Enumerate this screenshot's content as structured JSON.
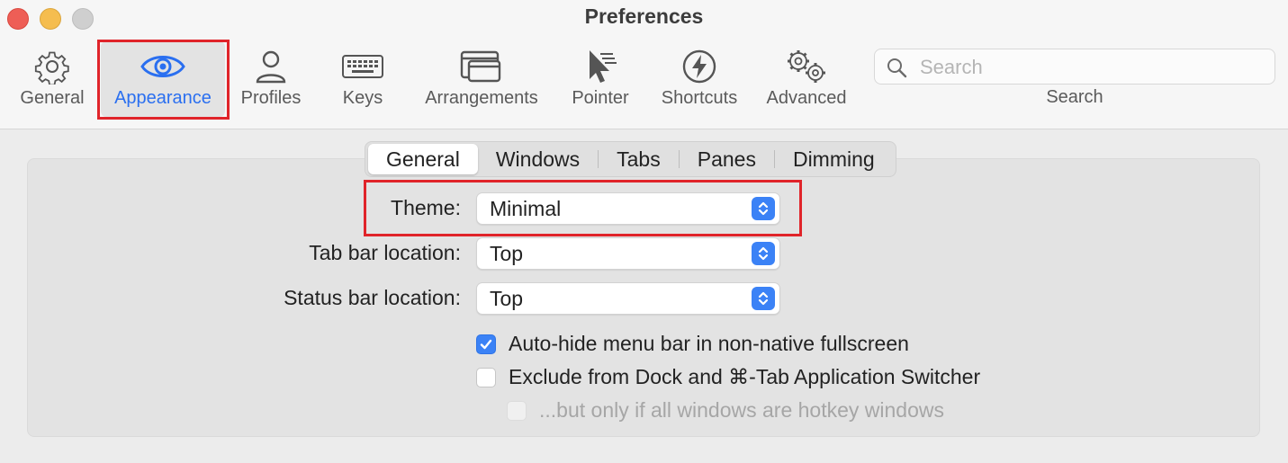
{
  "window": {
    "title": "Preferences"
  },
  "toolbar": {
    "items": [
      {
        "label": "General",
        "icon": "gear-icon"
      },
      {
        "label": "Appearance",
        "icon": "eye-icon",
        "active": true
      },
      {
        "label": "Profiles",
        "icon": "person-icon"
      },
      {
        "label": "Keys",
        "icon": "keyboard-icon"
      },
      {
        "label": "Arrangements",
        "icon": "windows-icon"
      },
      {
        "label": "Pointer",
        "icon": "pointer-icon"
      },
      {
        "label": "Shortcuts",
        "icon": "lightning-icon"
      },
      {
        "label": "Advanced",
        "icon": "gears-icon"
      }
    ],
    "search": {
      "placeholder": "Search",
      "label": "Search"
    }
  },
  "tabs": {
    "items": [
      "General",
      "Windows",
      "Tabs",
      "Panes",
      "Dimming"
    ],
    "selected": "General"
  },
  "form": {
    "theme": {
      "label": "Theme:",
      "value": "Minimal"
    },
    "tab_bar_location": {
      "label": "Tab bar location:",
      "value": "Top"
    },
    "status_bar_location": {
      "label": "Status bar location:",
      "value": "Top"
    },
    "checkboxes": [
      {
        "label": "Auto-hide menu bar in non-native fullscreen",
        "checked": true,
        "disabled": false
      },
      {
        "label": "Exclude from Dock and ⌘-Tab Application Switcher",
        "checked": false,
        "disabled": false
      },
      {
        "label": "...but only if all windows are hotkey windows",
        "checked": false,
        "disabled": true
      }
    ]
  },
  "colors": {
    "accent": "#3b82f6",
    "highlight_box": "#e0242a",
    "active_label": "#2a6ff0"
  }
}
